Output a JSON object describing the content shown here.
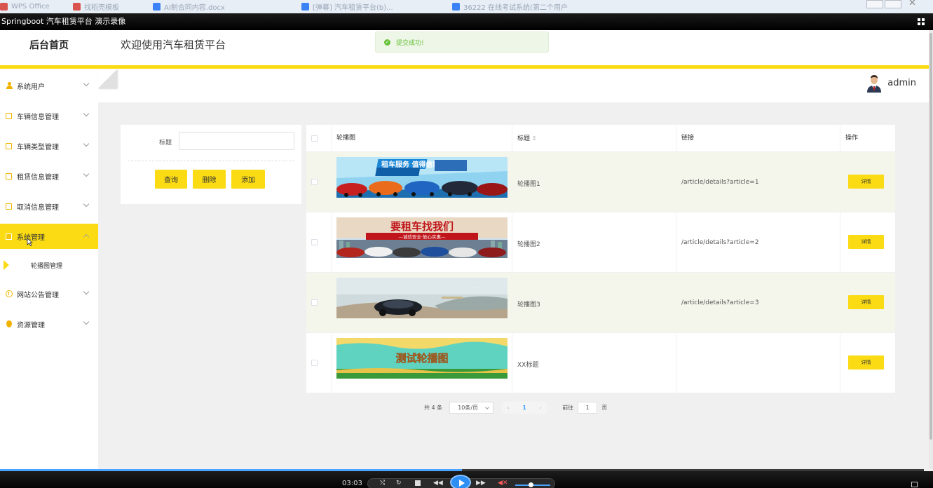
{
  "browser_tabs": [
    {
      "label": "WPS Office",
      "color": "#d9534f"
    },
    {
      "label": "找稻壳模板",
      "color": "#d9534f"
    },
    {
      "label": "AI制合同内容.docx",
      "color": "#3b82f6"
    },
    {
      "label": "[弹幕] 汽车租赁平台(b)...",
      "color": "#3b82f6"
    },
    {
      "label": "36222 在线考试系统(第二个用户",
      "color": "#3b82f6"
    }
  ],
  "player": {
    "title": "Springboot 汽车租赁平台 演示录像",
    "time": "03:03",
    "progress": 0.5
  },
  "header": {
    "brand": "后台首页",
    "welcome": "欢迎使用汽车租赁平台",
    "toast": "提交成功!"
  },
  "user": {
    "name": "admin"
  },
  "sidebar": {
    "items": [
      {
        "label": "系统用户",
        "icon": "person-icon"
      },
      {
        "label": "车辆信息管理",
        "icon": "edit-icon"
      },
      {
        "label": "车辆类型管理",
        "icon": "edit-icon"
      },
      {
        "label": "租赁信息管理",
        "icon": "edit-icon"
      },
      {
        "label": "取消信息管理",
        "icon": "edit-icon"
      },
      {
        "label": "系统管理",
        "icon": "settings-icon",
        "active": true
      },
      {
        "label": "网站公告管理",
        "icon": "info-icon"
      },
      {
        "label": "资源管理",
        "icon": "location-pin-icon"
      }
    ],
    "sub_item": "轮播图管理"
  },
  "search": {
    "title_label": "标题",
    "title_value": "",
    "query_btn": "查询",
    "delete_btn": "删除",
    "add_btn": "添加"
  },
  "table": {
    "headers": {
      "image": "轮播图",
      "title": "标题",
      "sort_icon": "sort-icon",
      "link": "链接",
      "action": "操作"
    },
    "rows": [
      {
        "title": "轮播图1",
        "link": "/article/details?article=1",
        "action": "详情",
        "banner_text": "租车服务 值得信赖"
      },
      {
        "title": "轮播图2",
        "link": "/article/details?article=2",
        "action": "详情",
        "banner_text": "要租车找我们",
        "banner_sub": "—诚信安全·放心实惠—"
      },
      {
        "title": "轮播图3",
        "link": "/article/details?article=3",
        "action": "详情",
        "banner_text": ""
      },
      {
        "title": "XX标题",
        "link": "",
        "action": "详情",
        "banner_text": "测试轮播图"
      }
    ]
  },
  "pagination": {
    "total": "共 4 条",
    "page_size": "10条/页",
    "current_page": "1",
    "goto_label": "前往",
    "goto_value": "1",
    "page_unit": "页"
  },
  "colors": {
    "accent": "#fadb14",
    "success": "#67c23a",
    "link_blue": "#409eff"
  }
}
